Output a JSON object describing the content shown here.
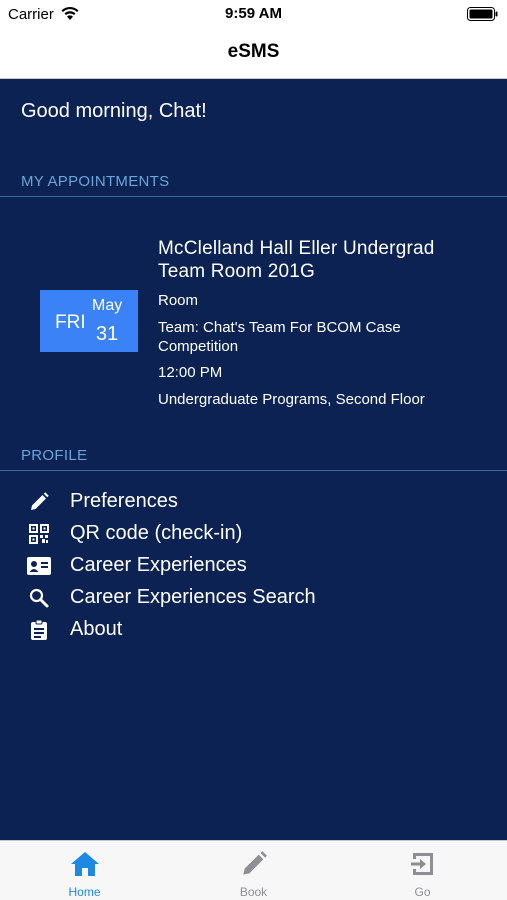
{
  "status_bar": {
    "carrier": "Carrier",
    "time": "9:59 AM"
  },
  "nav": {
    "title": "eSMS"
  },
  "greeting": "Good morning, Chat!",
  "appointments": {
    "header": "MY APPOINTMENTS",
    "items": [
      {
        "date": {
          "dow": "FRI",
          "month": "May",
          "day": "31"
        },
        "title": "McClelland Hall Eller Undergrad Team Room 201G",
        "type": "Room",
        "team": "Team: Chat's Team For BCOM Case Competition",
        "time": "12:00 PM",
        "location": "Undergraduate Programs, Second Floor"
      }
    ]
  },
  "profile": {
    "header": "PROFILE",
    "items": [
      {
        "label": "Preferences",
        "icon": "pencil-icon"
      },
      {
        "label": "QR code (check-in)",
        "icon": "qr-code-icon"
      },
      {
        "label": "Career Experiences",
        "icon": "id-card-icon"
      },
      {
        "label": "Career Experiences Search",
        "icon": "search-icon"
      },
      {
        "label": "About",
        "icon": "clipboard-icon"
      }
    ]
  },
  "tabs": [
    {
      "label": "Home",
      "icon": "home-icon",
      "active": true
    },
    {
      "label": "Book",
      "icon": "pencil-icon",
      "active": false
    },
    {
      "label": "Go",
      "icon": "exit-icon",
      "active": false
    }
  ],
  "colors": {
    "background": "#0b2252",
    "accent": "#3b82f6",
    "section_header": "#6aa6d8",
    "tab_active": "#1e88e5",
    "tab_inactive": "#8e8e93"
  }
}
